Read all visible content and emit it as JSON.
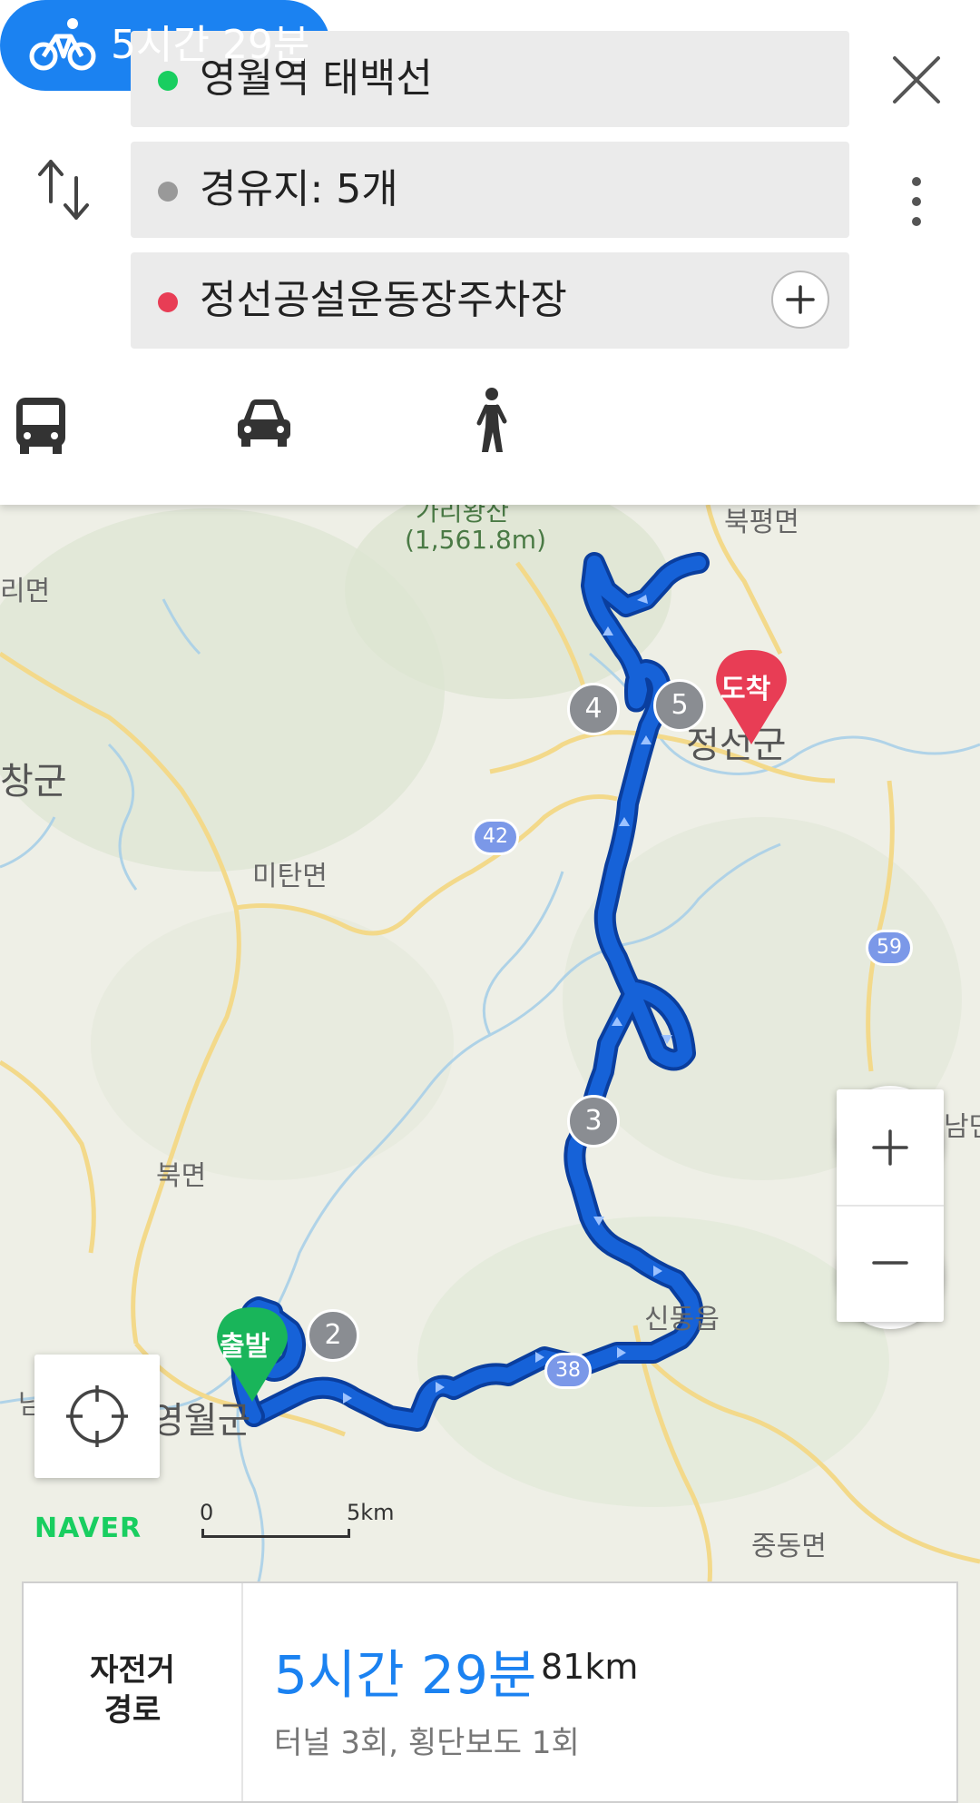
{
  "search": {
    "origin": "영월역 태백선",
    "waypoints": "경유지: 5개",
    "destination": "정선공설운동장주차장"
  },
  "modes": {
    "active": "bike",
    "bike_label": "5시간 29분"
  },
  "map": {
    "place_labels": [
      {
        "id": "peak",
        "text": "가리왕산"
      },
      {
        "id": "peak-alt",
        "text": "(1,561.8m)"
      },
      {
        "id": "bukpyeong",
        "text": "북평면"
      },
      {
        "id": "imyeon",
        "text": "리면"
      },
      {
        "id": "pyeongchang",
        "text": "창군"
      },
      {
        "id": "mitan",
        "text": "미탄면"
      },
      {
        "id": "jeongseon",
        "text": "정선군"
      },
      {
        "id": "bukmyeon",
        "text": "북면"
      },
      {
        "id": "sindong",
        "text": "신동읍"
      },
      {
        "id": "yeongwol",
        "text": "영월군"
      },
      {
        "id": "jungdong",
        "text": "중동면"
      },
      {
        "id": "nam",
        "text": "남"
      },
      {
        "id": "right-edge",
        "text": "남면"
      }
    ],
    "road_shields": [
      "42",
      "59",
      "38"
    ],
    "waypoint_markers": [
      "2",
      "3",
      "4",
      "5"
    ],
    "start_pin": "출발",
    "end_pin": "도착",
    "logo": "NAVER",
    "scale": {
      "zero": "0",
      "distance": "5km"
    },
    "colors": {
      "route": "#1662d8",
      "start": "#19b55a",
      "end": "#e83d55",
      "accent": "#1b82f1"
    }
  },
  "route_card": {
    "type_line1": "자전거",
    "type_line2": "경로",
    "duration": "5시간 29분",
    "distance": "81km",
    "details": "터널 3회, 횡단보도 1회"
  }
}
